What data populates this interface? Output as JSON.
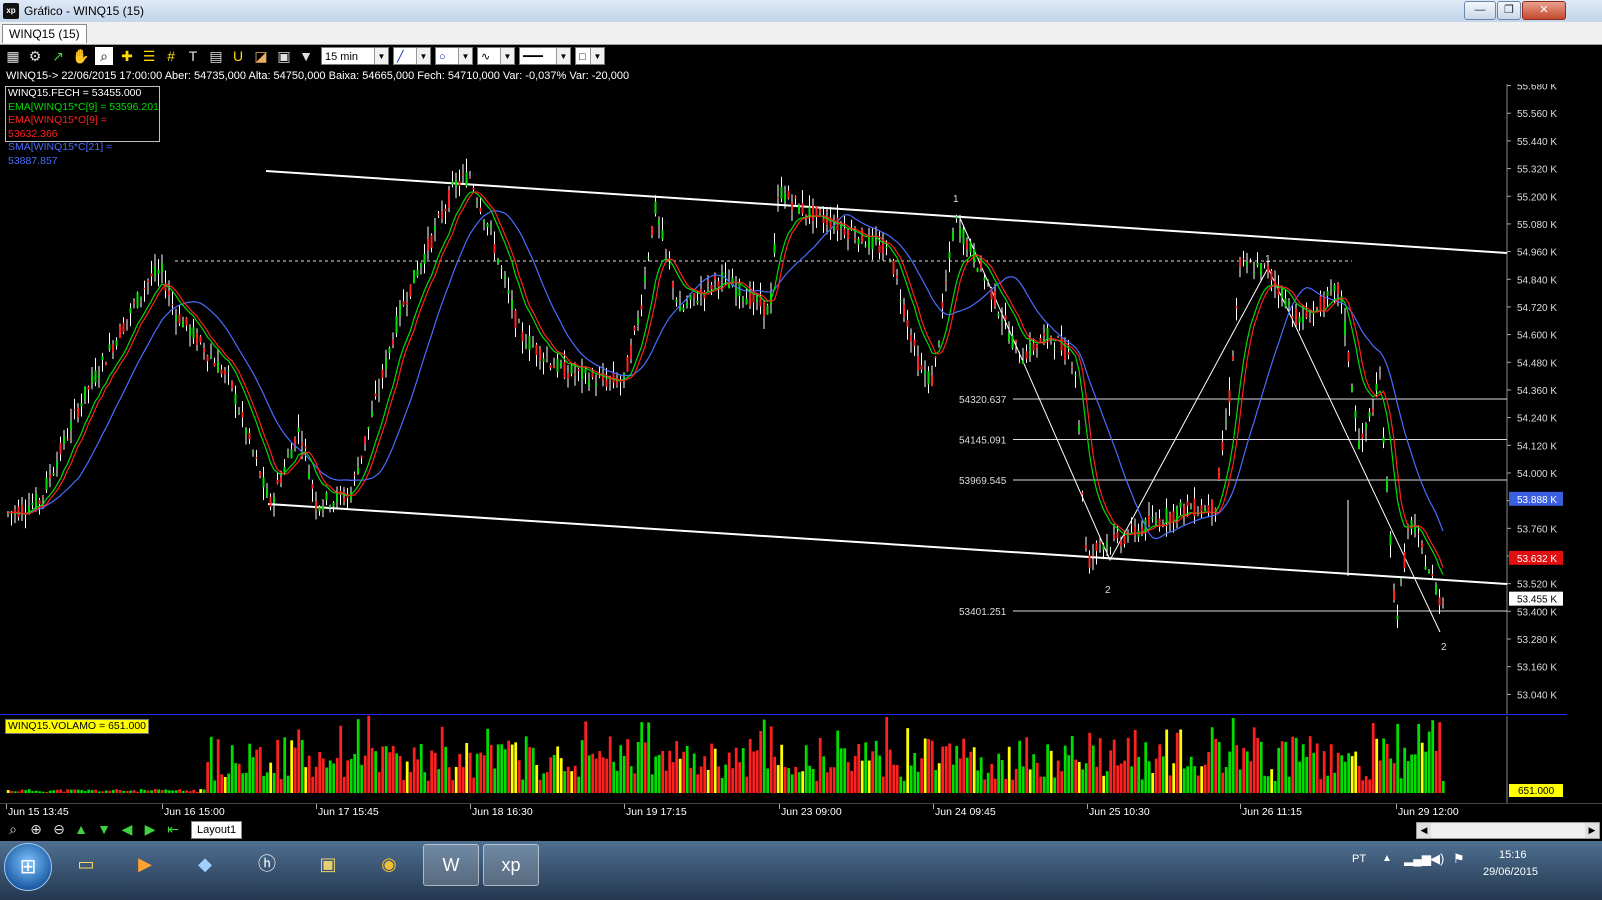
{
  "window": {
    "title": "Gráfico - WINQ15 (15)",
    "app_icon_text": "xp",
    "buttons": {
      "minimize": "—",
      "restore": "❐",
      "close": "✕"
    }
  },
  "tab": {
    "label": "WINQ15 (15)"
  },
  "toolbar": {
    "icons": [
      "chart-icon",
      "gear-icon",
      "indicator-icon",
      "hand-icon",
      "zoom-area-icon",
      "crosshair-icon",
      "fibonacci-icon",
      "grid-icon",
      "text-icon",
      "calculator-icon",
      "magnet-icon",
      "eraser-icon",
      "clipboard-icon",
      "filter-icon"
    ],
    "interval": "15 min"
  },
  "info_line": "WINQ15-> 22/06/2015 17:00:00 Aber: 54735,000 Alta: 54750,000 Baixa: 54665,000 Fech: 54710,000 Var: -0,037% Var: -20,000",
  "legend": [
    {
      "text": "WINQ15.FECH = 53455.000",
      "color": "#ffffff"
    },
    {
      "text": "EMA[WINQ15*C[9] = 53596.201",
      "color": "#00dd00"
    },
    {
      "text": "EMA[WINQ15*O[9] = 53632.366",
      "color": "#ff2020"
    },
    {
      "text": "SMA[WINQ15*C[21] = 53887.857",
      "color": "#4a6cff"
    }
  ],
  "price_axis": {
    "ticks": [
      "55.680 K",
      "55.560 K",
      "55.440 K",
      "55.320 K",
      "55.200 K",
      "55.080 K",
      "54.960 K",
      "54.840 K",
      "54.720 K",
      "54.600 K",
      "54.480 K",
      "54.360 K",
      "54.240 K",
      "54.120 K",
      "54.000 K",
      "53.880 K",
      "53.760 K",
      "53.640 K",
      "53.520 K",
      "53.400 K",
      "53.280 K",
      "53.160 K",
      "53.040 K"
    ],
    "badges": [
      {
        "text": "53.888 K",
        "color": "#3a5fe0",
        "value": 53888
      },
      {
        "text": "53.632 K",
        "color": "#e01010",
        "value": 53632
      },
      {
        "text": "53.455 K",
        "color": "#ffffff",
        "value": 53455
      }
    ]
  },
  "fib_levels": [
    {
      "label": "54320.637",
      "value": 54320.637
    },
    {
      "label": "54145.091",
      "value": 54145.091
    },
    {
      "label": "53969.545",
      "value": 53969.545
    },
    {
      "label": "53401.251",
      "value": 53401.251
    }
  ],
  "wave_labels": [
    "1",
    "1",
    "2",
    "2"
  ],
  "volume": {
    "legend": "WINQ15.VOLAMO = 651.000",
    "axis_badge": "651.000"
  },
  "time_axis": [
    "Jun 15 13:45",
    "Jun 16 15:00",
    "Jun 17 15:45",
    "Jun 18 16:30",
    "Jun 19 17:15",
    "Jun 23 09:00",
    "Jun 24 09:45",
    "Jun 25 10:30",
    "Jun 26 11:15",
    "Jun 29 12:00"
  ],
  "bottom_toolbar": {
    "icons": [
      "zoom-out-icon",
      "zoom-in-icon",
      "zoom-minus-icon",
      "arrow-up-icon",
      "arrow-down-icon",
      "arrow-left-icon",
      "arrow-right-icon",
      "arrow-first-icon"
    ],
    "layout_tab": "Layout1"
  },
  "taskbar": {
    "apps": [
      "explorer-icon",
      "media-player-icon",
      "network-icon",
      "hp-icon",
      "cashier-icon",
      "chrome-icon",
      "word-icon",
      "xp-icon"
    ],
    "lang": "PT",
    "time": "15:16",
    "date": "29/06/2015"
  },
  "chart_data": {
    "type": "candlestick",
    "title": "WINQ15 (15)",
    "interval": "15 min",
    "ylim": [
      52960,
      55700
    ],
    "key_points": [
      {
        "x": "Jun 15 13:45",
        "y": 53820
      },
      {
        "x": "Jun 16 15:00",
        "y": 54870
      },
      {
        "x": "Jun 17 15:45",
        "y": 53870
      },
      {
        "x": "Jun 18 16:30",
        "y": 55290
      },
      {
        "x": "Jun 19 17:15",
        "y": 54400
      },
      {
        "x": "Jun 23 09:00",
        "y": 55230
      },
      {
        "x": "Jun 24 09:45",
        "y": 54400
      },
      {
        "x": "Jun 25 10:30",
        "y": 53600
      },
      {
        "x": "Jun 26 11:15",
        "y": 54900
      },
      {
        "x": "Jun 29 12:00",
        "y": 53350
      }
    ],
    "last_close": 53455,
    "series": [
      {
        "name": "EMA[WINQ15*C[9]",
        "last": 53596.201
      },
      {
        "name": "EMA[WINQ15*O[9]",
        "last": 53632.366
      },
      {
        "name": "SMA[WINQ15*C[21]",
        "last": 53887.857
      }
    ]
  }
}
